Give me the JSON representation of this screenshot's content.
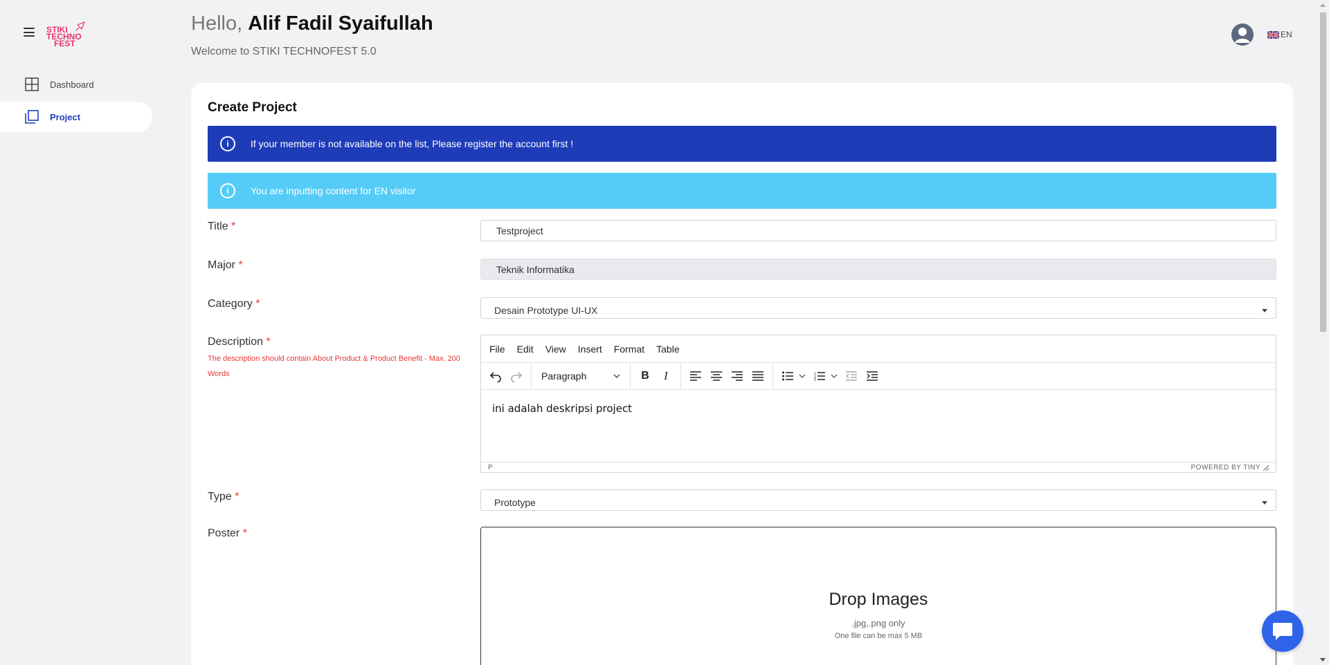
{
  "sidebar": {
    "logo_line1": "STIKI",
    "logo_line2": "TECHNO",
    "logo_line3": "FEST",
    "items": [
      {
        "label": "Dashboard",
        "icon": "grid-icon"
      },
      {
        "label": "Project",
        "icon": "copy-icon"
      }
    ]
  },
  "header": {
    "greeting_prefix": "Hello,",
    "user_name": "Alif Fadil Syaifullah",
    "welcome": "Welcome to STIKI TECHNOFEST 5.0",
    "language": "EN"
  },
  "form": {
    "title": "Create Project",
    "alert_primary": "If your member is not available on the list, Please register the account first !",
    "alert_info": "You are inputting content for EN visitor",
    "title_label": "Title",
    "title_value": "Testproject",
    "major_label": "Major",
    "major_value": "Teknik Informatika",
    "category_label": "Category",
    "category_value": "Desain Prototype UI-UX",
    "description_label": "Description",
    "description_hint": "The description should contain About Product & Product Benefit - Max. 200 Words",
    "type_label": "Type",
    "type_value": "Prototype",
    "poster_label": "Poster",
    "required_mark": "*"
  },
  "editor": {
    "menu": [
      "File",
      "Edit",
      "View",
      "Insert",
      "Format",
      "Table"
    ],
    "block_format": "Paragraph",
    "content": "ini adalah deskripsi project",
    "path": "P",
    "powered_by": "POWERED BY TINY"
  },
  "dropzone": {
    "title": "Drop Images",
    "formats": ".jpg,.png only",
    "limit": "One file can be max 5 MB"
  },
  "colors": {
    "primary": "#1f3cb8",
    "info": "#55ccf7",
    "brand": "#e8336e",
    "required": "#e53935",
    "chat": "#2f64e8"
  }
}
